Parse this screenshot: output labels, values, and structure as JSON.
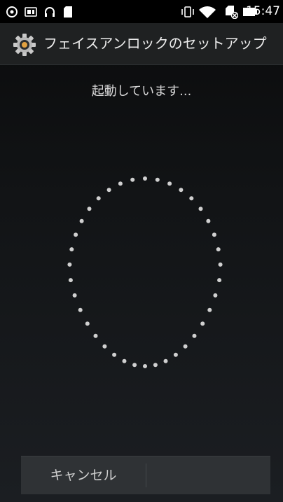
{
  "status_bar": {
    "icons_left": [
      "settings-gear-icon",
      "sim-card-icon",
      "headset-icon",
      "sd-card-icon"
    ],
    "icons_right": [
      "vibrate-icon",
      "wifi-icon",
      "no-sim-icon",
      "battery-icon"
    ],
    "time": "15:47"
  },
  "action_bar": {
    "icon": "settings-gear-icon",
    "title": "フェイスアンロックのセットアップ"
  },
  "main": {
    "message": "起動しています..."
  },
  "face_oval": {
    "dot_count": 38,
    "dot_color": "#d0d0d0"
  },
  "button_bar": {
    "cancel_label": "キャンセル"
  }
}
